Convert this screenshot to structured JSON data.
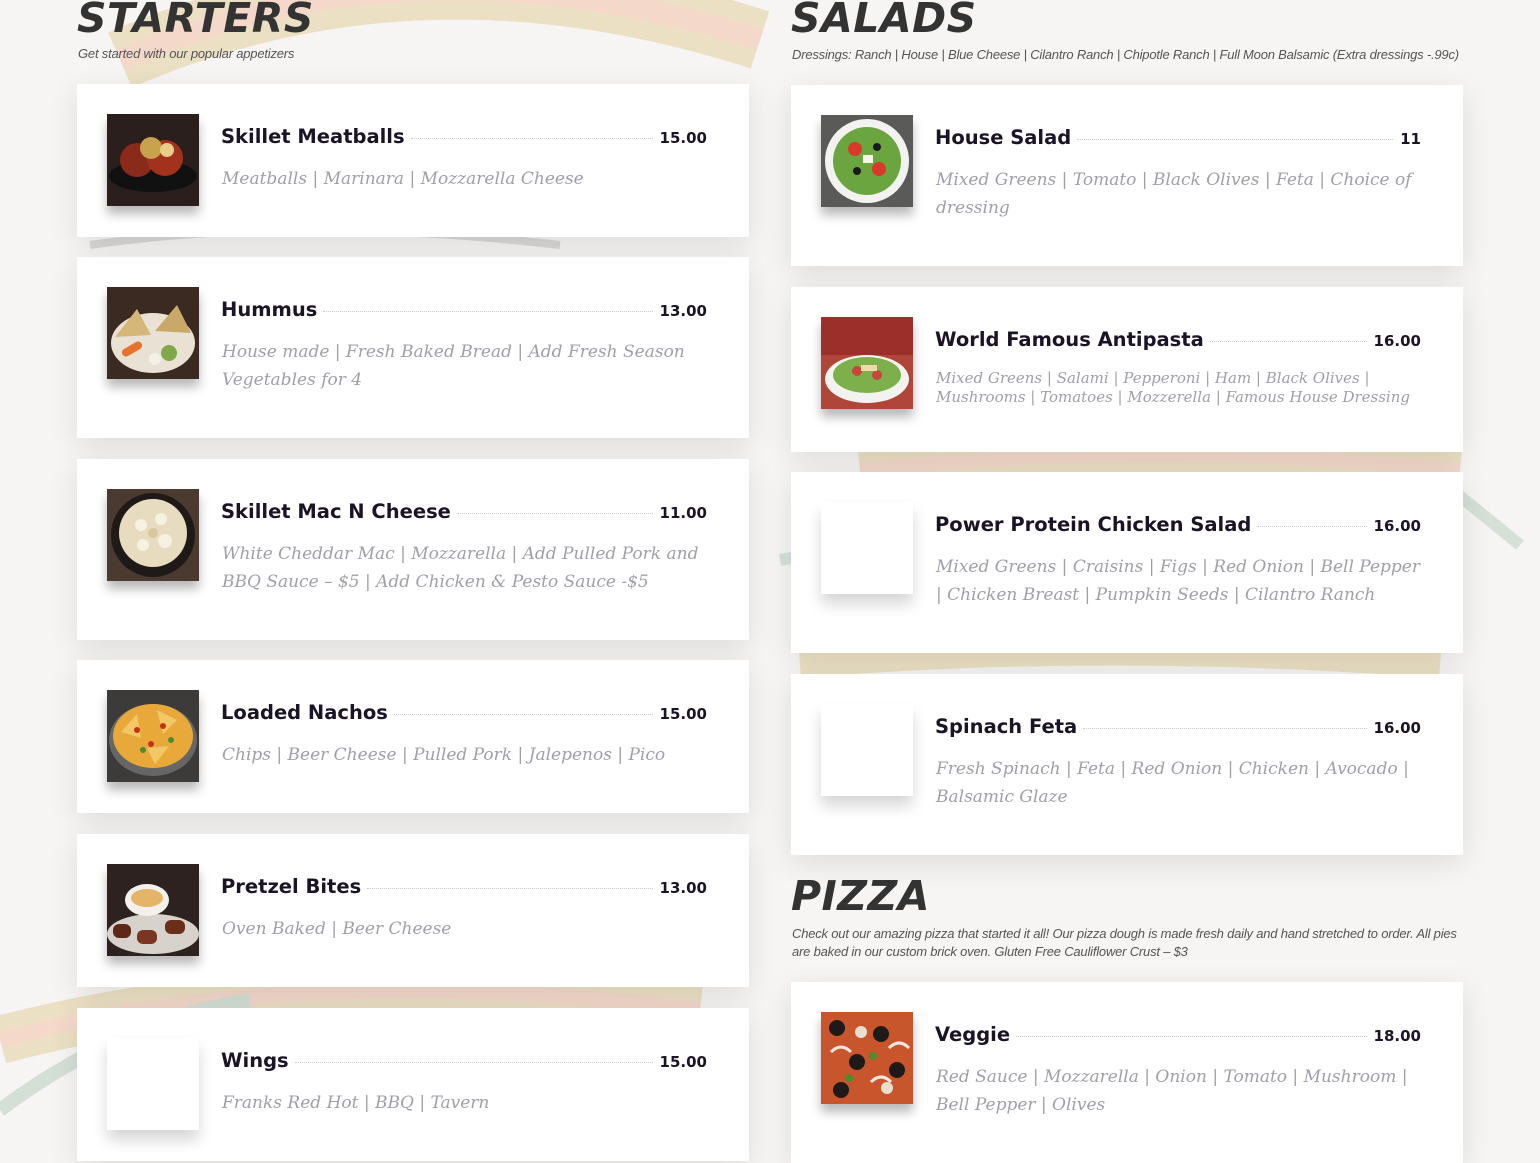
{
  "starters": {
    "title": "STARTERS",
    "subtitle": "Get started with our popular appetizers",
    "items": [
      {
        "name": "Skillet Meatballs",
        "price": "15.00",
        "description": "Meatballs | Marinara | Mozzarella Cheese",
        "image": "meatballs-photo"
      },
      {
        "name": "Hummus",
        "price": "13.00",
        "description": "House made | Fresh Baked Bread | Add Fresh Season Vegetables for 4",
        "image": "hummus-photo"
      },
      {
        "name": "Skillet Mac N Cheese",
        "price": "11.00",
        "description": "White Cheddar Mac | Mozzarella | Add Pulled Pork and BBQ Sauce – $5 | Add Chicken & Pesto Sauce -$5",
        "image": "mac-n-cheese-photo"
      },
      {
        "name": "Loaded Nachos",
        "price": "15.00",
        "description": "Chips | Beer Cheese | Pulled Pork | Jalepenos | Pico",
        "image": "nachos-photo"
      },
      {
        "name": "Pretzel Bites",
        "price": "13.00",
        "description": "Oven Baked | Beer Cheese",
        "image": "pretzel-bites-photo"
      },
      {
        "name": "Wings",
        "price": "15.00",
        "description": "Franks Red Hot | BBQ | Tavern",
        "image": "blank-photo"
      }
    ]
  },
  "salads": {
    "title": "SALADS",
    "subtitle": "Dressings: Ranch | House | Blue Cheese | Cilantro Ranch | Chipotle Ranch | Full Moon Balsamic (Extra dressings -.99c)",
    "items": [
      {
        "name": "House Salad",
        "price": "11",
        "description": "Mixed Greens | Tomato | Black Olives | Feta | Choice of dressing",
        "image": "house-salad-photo"
      },
      {
        "name": "World Famous Antipasta",
        "price": "16.00",
        "description": "Mixed Greens | Salami | Pepperoni | Ham | Black Olives | Mushrooms  | Tomatoes | Mozzerella | Famous House Dressing",
        "image": "antipasta-photo"
      },
      {
        "name": "Power Protein Chicken Salad",
        "price": "16.00",
        "description": "Mixed Greens | Craisins | Figs | Red Onion | Bell Pepper | Chicken Breast | Pumpkin Seeds | Cilantro Ranch",
        "image": "blank-photo"
      },
      {
        "name": "Spinach Feta",
        "price": "16.00",
        "description": "Fresh Spinach | Feta | Red Onion | Chicken | Avocado | Balsamic Glaze",
        "image": "blank-photo"
      }
    ]
  },
  "pizza": {
    "title": "PIZZA",
    "subtitle": "Check out our amazing pizza that started it all! Our pizza dough is made fresh daily and hand stretched to order. All pies are baked in our custom brick oven. Gluten Free Cauliflower Crust – $3",
    "items": [
      {
        "name": "Veggie",
        "price": "18.00",
        "description": "Red Sauce | Mozzarella | Onion | Tomato | Mushroom | Bell Pepper | Olives",
        "image": "veggie-pizza-photo"
      }
    ]
  },
  "colors": {
    "item_name": "#1a1426",
    "description": "#a09fa6",
    "section_title": "#333333",
    "background": "#f6f5f3"
  }
}
